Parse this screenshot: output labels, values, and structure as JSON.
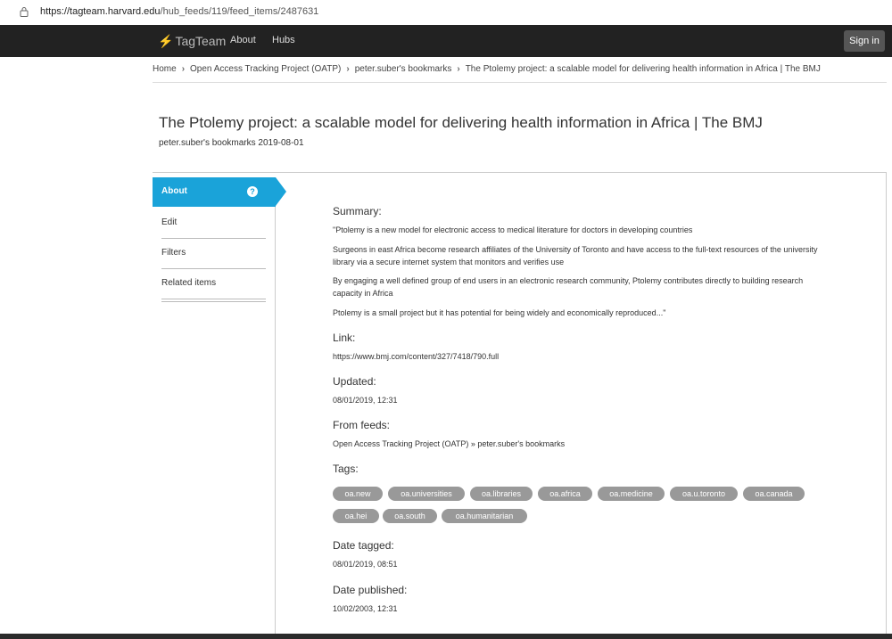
{
  "browser": {
    "url_host": "https://tagteam.harvard.edu",
    "url_path": "/hub_feeds/119/feed_items/2487631"
  },
  "navbar": {
    "brand": "TagTeam",
    "links": [
      "About",
      "Hubs"
    ],
    "signin": "Sign in"
  },
  "breadcrumb": [
    "Home",
    "Open Access Tracking Project (OATP)",
    "peter.suber's bookmarks",
    "The Ptolemy project: a scalable model for delivering health information in Africa | The BMJ"
  ],
  "page": {
    "title": "The Ptolemy project: a scalable model for delivering health information in Africa | The BMJ",
    "subtitle": "peter.suber's bookmarks 2019-08-01"
  },
  "sidebar": {
    "active": "About",
    "items": [
      "Edit",
      "Filters",
      "Related items"
    ]
  },
  "about": {
    "summary_heading": "Summary:",
    "summary": [
      "\"Ptolemy is a new model for electronic access to medical literature for doctors in developing countries",
      "Surgeons in east Africa become research affiliates of the University of Toronto and have access to the full-text resources of the university library via a secure internet system that monitors and verifies use",
      "By engaging a well defined group of end users in an electronic research community, Ptolemy contributes directly to building research capacity in Africa",
      "Ptolemy is a small project but it has potential for being widely and economically reproduced...\""
    ],
    "link_heading": "Link:",
    "link": "https://www.bmj.com/content/327/7418/790.full",
    "updated_heading": "Updated:",
    "updated": "08/01/2019, 12:31",
    "feeds_heading": "From feeds:",
    "feeds": "Open Access Tracking Project (OATP) » peter.suber's bookmarks",
    "tags_heading": "Tags:",
    "tags": [
      "oa.new",
      "oa.universities",
      "oa.libraries",
      "oa.africa",
      "oa.medicine",
      "oa.u.toronto",
      "oa.canada",
      "oa.hei",
      "oa.south",
      "oa.humanitarian"
    ],
    "date_tagged_heading": "Date tagged:",
    "date_tagged": "08/01/2019, 08:51",
    "date_published_heading": "Date published:",
    "date_published": "10/02/2003, 12:31"
  },
  "colors": {
    "navbar_bg": "#222222",
    "accent": "#1aa3d9",
    "tag_bg": "#999999"
  }
}
